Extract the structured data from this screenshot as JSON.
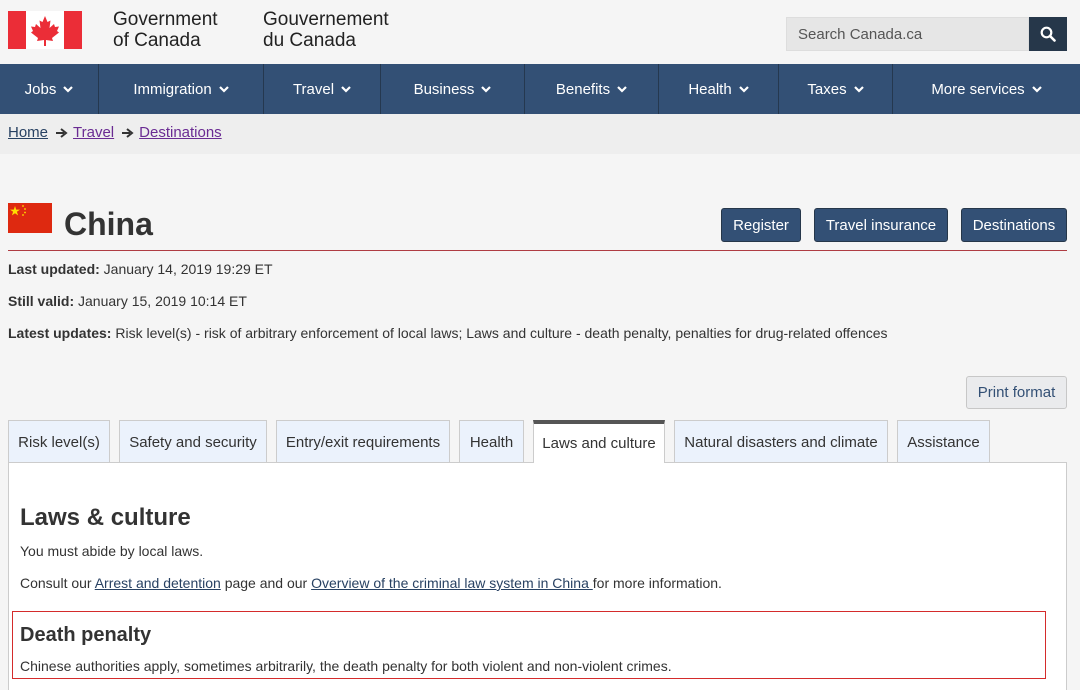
{
  "header": {
    "gov_en_line1": "Government",
    "gov_en_line2": "of Canada",
    "gov_fr_line1": "Gouvernement",
    "gov_fr_line2": "du Canada",
    "search_placeholder": "Search Canada.ca",
    "search_icon": "search-icon"
  },
  "menu": {
    "items": [
      {
        "label": "Jobs"
      },
      {
        "label": "Immigration"
      },
      {
        "label": "Travel"
      },
      {
        "label": "Business"
      },
      {
        "label": "Benefits"
      },
      {
        "label": "Health"
      },
      {
        "label": "Taxes"
      },
      {
        "label": "More services"
      }
    ]
  },
  "breadcrumb": {
    "items": [
      "Home",
      "Travel",
      "Destinations"
    ]
  },
  "page": {
    "title": "China",
    "buttons": {
      "register": "Register",
      "insurance": "Travel insurance",
      "destinations": "Destinations"
    },
    "last_updated_label": "Last updated:",
    "last_updated_value": "January 14, 2019 19:29 ET",
    "still_valid_label": "Still valid:",
    "still_valid_value": "January 15, 2019 10:14 ET",
    "latest_updates_label": "Latest updates:",
    "latest_updates_value": "Risk level(s) - risk of arbitrary enforcement of local laws; Laws and culture - death penalty, penalties for drug-related offences",
    "print_label": "Print format"
  },
  "tabs": [
    {
      "label": "Risk level(s)"
    },
    {
      "label": "Safety and security"
    },
    {
      "label": "Entry/exit requirements"
    },
    {
      "label": "Health"
    },
    {
      "label": "Laws and culture"
    },
    {
      "label": "Natural disasters and climate"
    },
    {
      "label": "Assistance"
    }
  ],
  "content": {
    "title": "Laws & culture",
    "intro": "You must abide by local laws.",
    "consult_prefix": "Consult our ",
    "consult_link1": "Arrest and detention",
    "consult_middle": " page and our ",
    "consult_link2": "Overview of the criminal law system in China ",
    "consult_suffix": "for more information.",
    "death_penalty_title": "Death penalty",
    "death_penalty_text": "Chinese authorities apply, sometimes arbitrarily, the death penalty for both violent and non-violent crimes."
  },
  "colors": {
    "menu_bg": "#335075",
    "button_bg": "#335075",
    "canada_red": "#eb2d37",
    "china_red": "#de2910",
    "china_yellow": "#ffde00",
    "highlight_border": "#d42b2b"
  }
}
